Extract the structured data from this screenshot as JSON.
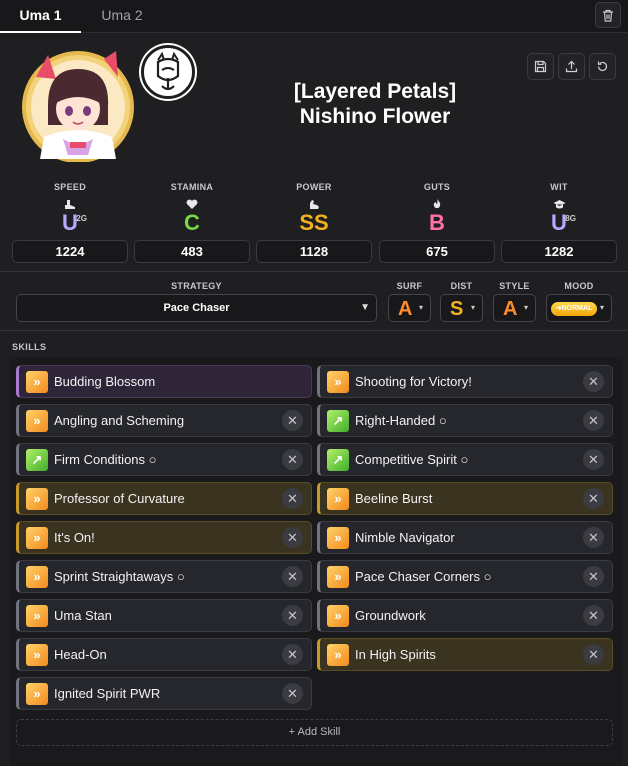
{
  "tabs": [
    {
      "label": "Uma 1",
      "active": true
    },
    {
      "label": "Uma 2",
      "active": false
    }
  ],
  "header": {
    "title_line1": "[Layered Petals]",
    "title_line2": "Nishino Flower",
    "icons": {
      "delete": "trash-icon",
      "save": "save-icon",
      "export": "upload-icon",
      "reset": "reset-icon"
    }
  },
  "stats": [
    {
      "label": "SPEED",
      "grade": "U",
      "sub": "2G",
      "value": "1224",
      "color": "#b8a6ff",
      "icon": "shoe-icon"
    },
    {
      "label": "STAMINA",
      "grade": "C",
      "sub": "",
      "value": "483",
      "color": "#7bd646",
      "icon": "heart-icon"
    },
    {
      "label": "POWER",
      "grade": "SS",
      "sub": "",
      "value": "1128",
      "color": "#f2b21e",
      "icon": "muscle-icon"
    },
    {
      "label": "GUTS",
      "grade": "B",
      "sub": "",
      "value": "675",
      "color": "#ff6fa8",
      "icon": "flame-icon"
    },
    {
      "label": "WIT",
      "grade": "U",
      "sub": "8G",
      "value": "1282",
      "color": "#b8a6ff",
      "icon": "grad-cap-icon"
    }
  ],
  "strategy": {
    "label": "STRATEGY",
    "value": "Pace Chaser"
  },
  "aptitudes": [
    {
      "label": "SURF",
      "grade": "A",
      "color": "#ff8a2a"
    },
    {
      "label": "DIST",
      "grade": "S",
      "color": "#f2b21e"
    },
    {
      "label": "STYLE",
      "grade": "A",
      "color": "#ff8a2a"
    }
  ],
  "mood": {
    "label": "MOOD",
    "value": "NORMAL"
  },
  "skills_label": "SKILLS",
  "skills": [
    {
      "name": "Budding Blossom",
      "kind": "unique",
      "icon": "orange",
      "removable": false
    },
    {
      "name": "Shooting for Victory!",
      "kind": "normal",
      "icon": "orange",
      "removable": true
    },
    {
      "name": "Angling and Scheming",
      "kind": "normal",
      "icon": "orange",
      "removable": true
    },
    {
      "name": "Right-Handed ○",
      "kind": "normal",
      "icon": "green",
      "removable": true
    },
    {
      "name": "Firm Conditions ○",
      "kind": "normal",
      "icon": "green",
      "removable": true
    },
    {
      "name": "Competitive Spirit ○",
      "kind": "normal",
      "icon": "green",
      "removable": true
    },
    {
      "name": "Professor of Curvature",
      "kind": "gold",
      "icon": "orange",
      "removable": true
    },
    {
      "name": "Beeline Burst",
      "kind": "gold",
      "icon": "orange",
      "removable": true
    },
    {
      "name": "It's On!",
      "kind": "gold",
      "icon": "orange",
      "removable": true
    },
    {
      "name": "Nimble Navigator",
      "kind": "normal",
      "icon": "orange",
      "removable": true
    },
    {
      "name": "Sprint Straightaways ○",
      "kind": "normal",
      "icon": "orange",
      "removable": true
    },
    {
      "name": "Pace Chaser Corners ○",
      "kind": "normal",
      "icon": "orange",
      "removable": true
    },
    {
      "name": "Uma Stan",
      "kind": "normal",
      "icon": "orange",
      "removable": true
    },
    {
      "name": "Groundwork",
      "kind": "normal",
      "icon": "orange",
      "removable": true
    },
    {
      "name": "Head-On",
      "kind": "normal",
      "icon": "orange",
      "removable": true
    },
    {
      "name": "In High Spirits",
      "kind": "gold",
      "icon": "orange",
      "removable": true
    },
    {
      "name": "Ignited Spirit PWR",
      "kind": "normal",
      "icon": "orange",
      "removable": true
    }
  ],
  "add_skill_label": "+ Add Skill"
}
